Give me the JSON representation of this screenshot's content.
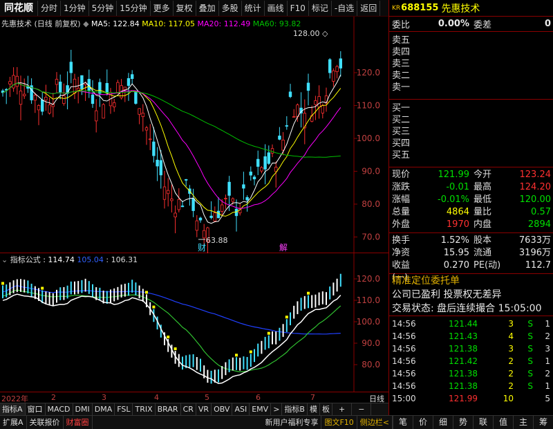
{
  "toolbar": {
    "logo": "同花顺",
    "items": [
      "分时",
      "1分钟",
      "5分钟",
      "15分钟",
      "更多",
      "复权",
      "叠加",
      "多股",
      "统计",
      "画线",
      "F10",
      "标记",
      "-自选",
      "返回"
    ]
  },
  "main_chart": {
    "legend": {
      "title": "先惠技术 (日线 前复权)",
      "ma5": "MA5: 122.84",
      "ma10": "MA10: 117.05",
      "ma20": "MA20: 112.49",
      "ma60": "MA60: 93.82"
    },
    "y_labels": [
      "120.0",
      "110.0",
      "100.0",
      "90.0",
      "80.0",
      "70.0"
    ],
    "high_marker": "128.00",
    "low_marker": "63.88",
    "event_cai": "财",
    "event_jie": "解"
  },
  "sub_chart": {
    "legend": {
      "name": "指标公式",
      "v1": ": 114.74",
      "v2": "105.04",
      "v3": ": 106.31"
    },
    "y_labels": [
      "120.0",
      "110.0",
      "100.0",
      "90.0",
      "80.0"
    ]
  },
  "date_axis": {
    "labels": [
      "2022年",
      "2",
      "3",
      "4",
      "5",
      "6",
      "7"
    ],
    "period": "日线"
  },
  "indicator_tabs": [
    "指标A",
    "窗口",
    "MACD",
    "DMI",
    "DMA",
    "FSL",
    "TRIX",
    "BRAR",
    "CR",
    "VR",
    "OBV",
    "ASI",
    "EMV",
    ">",
    "指标B",
    "模",
    "板",
    "+",
    "−"
  ],
  "bottom_bar": {
    "items": [
      "扩展A",
      "关联报价",
      "财富圈"
    ],
    "right_items": [
      "新用户福利专享",
      "图文F10",
      "侧边栏<"
    ],
    "tabs": [
      "笔",
      "价",
      "细",
      "势",
      "联",
      "值",
      "主",
      "筹"
    ]
  },
  "quote_panel": {
    "kr": "KR",
    "code": "688155",
    "name": "先惠技术",
    "weibi_label": "委比",
    "weibi_value": "0.00%",
    "weicha_label": "委差",
    "weicha_value": "0",
    "sells": [
      "卖五",
      "卖四",
      "卖三",
      "卖二",
      "卖一"
    ],
    "buys": [
      "买一",
      "买二",
      "买三",
      "买四",
      "买五"
    ],
    "rows1": [
      {
        "l1": "现价",
        "v1": "121.99",
        "c1": "green",
        "l2": "今开",
        "v2": "123.24",
        "c2": "red"
      },
      {
        "l1": "涨跌",
        "v1": "-0.01",
        "c1": "green",
        "l2": "最高",
        "v2": "124.20",
        "c2": "red"
      },
      {
        "l1": "涨幅",
        "v1": "-0.01%",
        "c1": "green",
        "l2": "最低",
        "v2": "120.00",
        "c2": "green"
      },
      {
        "l1": "总量",
        "v1": "4864",
        "c1": "yellow",
        "l2": "量比",
        "v2": "0.57",
        "c2": "green"
      },
      {
        "l1": "外盘",
        "v1": "1970",
        "c1": "red",
        "l2": "内盘",
        "v2": "2894",
        "c2": "green"
      }
    ],
    "rows2": [
      {
        "l1": "换手",
        "v1": "1.52%",
        "c1": "white",
        "l2": "股本",
        "v2": "7633万",
        "c2": "white"
      },
      {
        "l1": "净资",
        "v1": "15.95",
        "c1": "white",
        "l2": "流通",
        "v2": "3196万",
        "c2": "white"
      },
      {
        "l1": "收益(一)",
        "v1": "0.270",
        "c1": "white",
        "l2": "PE(动)",
        "v2": "112.7",
        "c2": "white"
      }
    ],
    "special": {
      "line1": "精准定位委托单",
      "line2": "公司已盈利 投票权无差异",
      "line3": "交易状态: 盘后连续撮合 15:05:00"
    },
    "ticks": [
      {
        "t": "14:56",
        "p": "121.44",
        "v": "3",
        "s": "S",
        "n": "1"
      },
      {
        "t": "14:56",
        "p": "121.43",
        "v": "4",
        "s": "S",
        "n": "2"
      },
      {
        "t": "14:56",
        "p": "121.38",
        "v": "3",
        "s": "S",
        "n": "3"
      },
      {
        "t": "14:56",
        "p": "121.42",
        "v": "2",
        "s": "S",
        "n": "1"
      },
      {
        "t": "14:56",
        "p": "121.38",
        "v": "2",
        "s": "S",
        "n": "2"
      },
      {
        "t": "14:56",
        "p": "121.38",
        "v": "2",
        "s": "S",
        "n": "1"
      },
      {
        "t": "15:00",
        "p": "121.99",
        "v": "10",
        "s": "",
        "n": "5"
      }
    ]
  },
  "colors": {
    "up": "#ff3030",
    "down": "#40e0ff",
    "ma5": "#ffffff",
    "ma10": "#ffff00",
    "ma20": "#ff00ff",
    "ma60": "#00c000",
    "border": "#8b0000"
  }
}
